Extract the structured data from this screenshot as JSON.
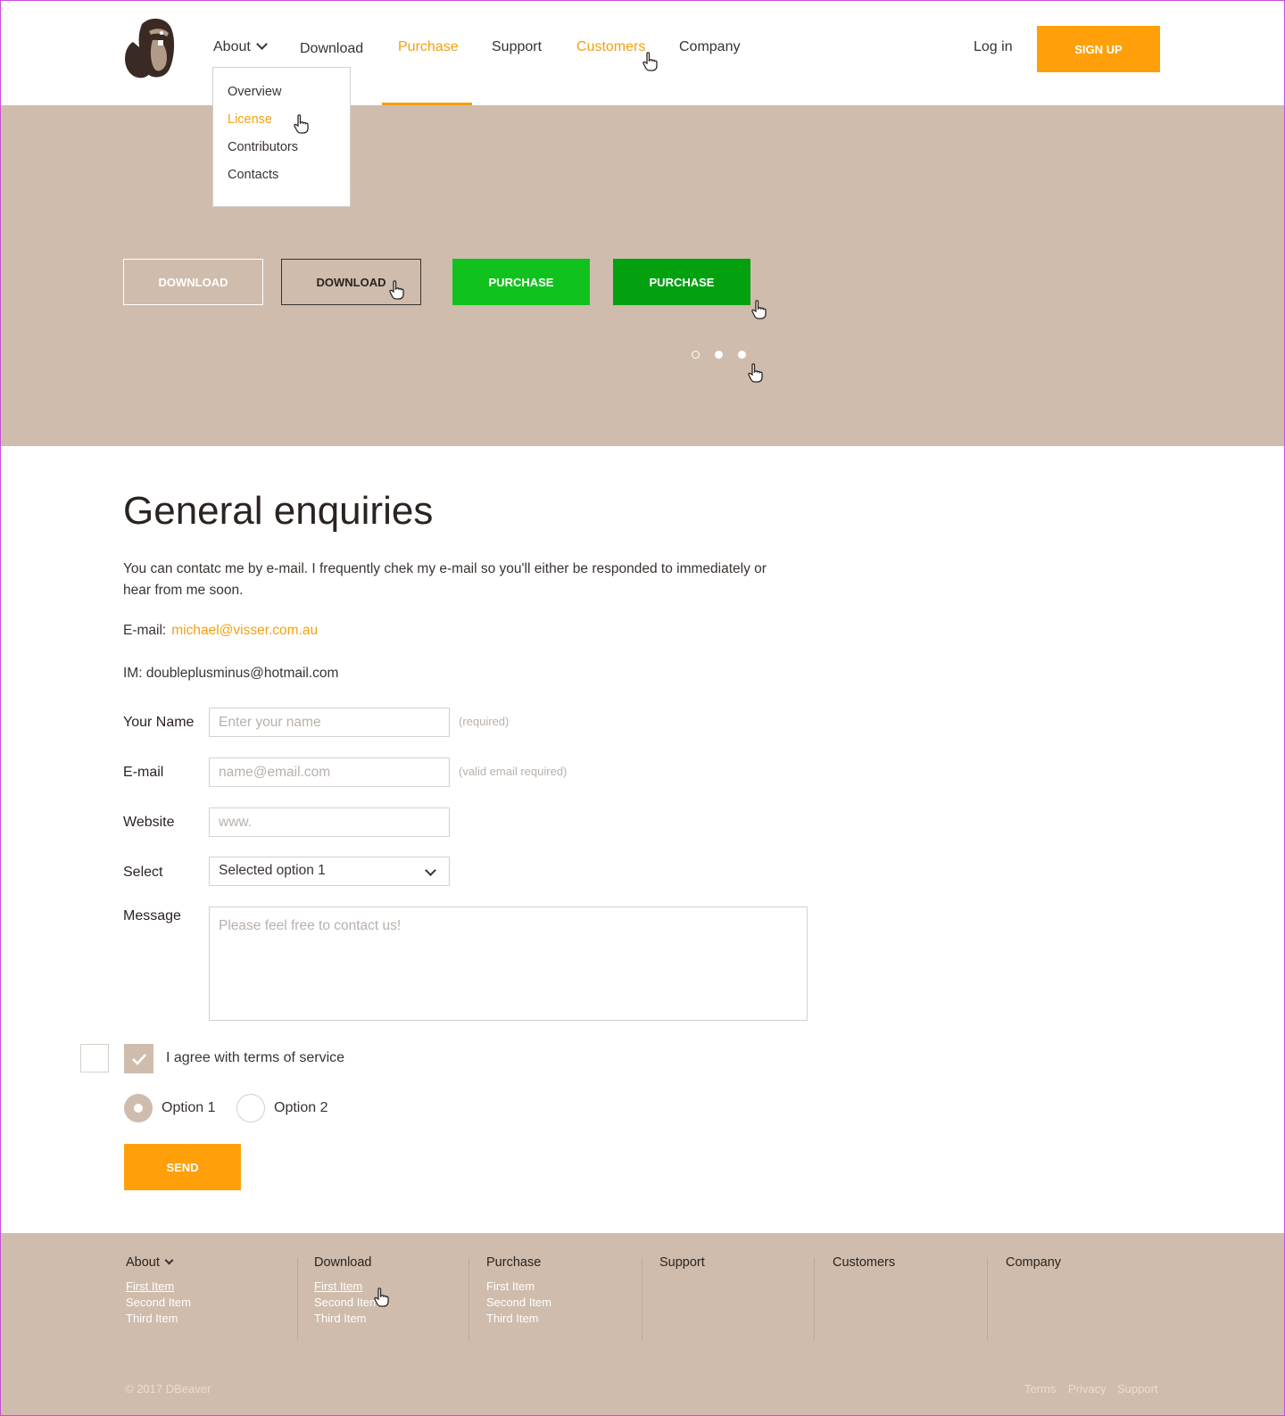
{
  "nav": {
    "items": [
      {
        "label": "About"
      },
      {
        "label": "Download"
      },
      {
        "label": "Purchase"
      },
      {
        "label": "Support"
      },
      {
        "label": "Customers"
      },
      {
        "label": "Company"
      }
    ],
    "login": "Log in",
    "signup": "SIGN UP"
  },
  "dropdown": {
    "items": [
      "Overview",
      "License",
      "Contributors",
      "Contacts"
    ]
  },
  "hero": {
    "buttons": [
      "DOWNLOAD",
      "DOWNLOAD",
      "PURCHASE",
      "PURCHASE"
    ]
  },
  "content": {
    "title": "General enquiries",
    "intro": "You can contatc me by e-mail. I frequently chek my e-mail so you'll either be responded to immediately or hear from me soon.",
    "email_label": "E-mail:",
    "email_value": "michael@visser.com.au",
    "im": "IM: doubleplusminus@hotmail.com"
  },
  "form": {
    "name_label": "Your Name",
    "name_placeholder": "Enter your name",
    "name_hint": "(required)",
    "email_label": "E-mail",
    "email_placeholder": "name@email.com",
    "email_hint": "(valid email required)",
    "website_label": "Website",
    "website_placeholder": "www.",
    "select_label": "Select",
    "select_value": "Selected option 1",
    "message_label": "Message",
    "message_placeholder": "Please feel free to contact us!",
    "agree_label": "I agree with terms of service",
    "option1": "Option 1",
    "option2": "Option 2",
    "send": "SEND"
  },
  "footer": {
    "columns": [
      {
        "title": "About",
        "links": [
          "First Item",
          "Second Item",
          "Third Item"
        ]
      },
      {
        "title": "Download",
        "links": [
          "First Item",
          "Second Item",
          "Third Item"
        ]
      },
      {
        "title": "Purchase",
        "links": [
          "First Item",
          "Second Item",
          "Third Item"
        ]
      },
      {
        "title": "Support",
        "links": []
      },
      {
        "title": "Customers",
        "links": []
      },
      {
        "title": "Company",
        "links": []
      }
    ],
    "copyright": "© 2017 DBeaver",
    "legal": [
      "Terms",
      "Privacy",
      "Support"
    ]
  },
  "colors": {
    "accent": "#ffa00a",
    "hero_bg": "#cfbcac",
    "green": "#11c21e",
    "green_dark": "#03a010"
  }
}
